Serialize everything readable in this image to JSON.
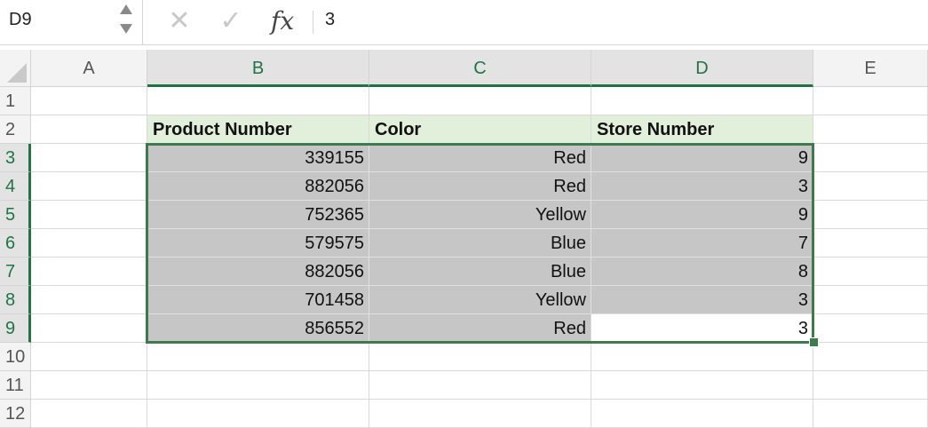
{
  "formula_bar": {
    "name_box": "D9",
    "cancel_icon": "✕",
    "enter_icon": "✓",
    "fx_label": "fx",
    "value": "3"
  },
  "columns": [
    "A",
    "B",
    "C",
    "D",
    "E"
  ],
  "rows": [
    "1",
    "2",
    "3",
    "4",
    "5",
    "6",
    "7",
    "8",
    "9",
    "10",
    "11",
    "12"
  ],
  "table": {
    "headers": [
      "Product Number",
      "Color",
      "Store Number"
    ],
    "rows": [
      [
        "339155",
        "Red",
        "9"
      ],
      [
        "882056",
        "Red",
        "3"
      ],
      [
        "752365",
        "Yellow",
        "9"
      ],
      [
        "579575",
        "Blue",
        "7"
      ],
      [
        "882056",
        "Blue",
        "8"
      ],
      [
        "701458",
        "Yellow",
        "3"
      ],
      [
        "856552",
        "Red",
        "3"
      ]
    ]
  },
  "selection": {
    "active_cell": "D9",
    "range": "B3:D9",
    "accent_color": "#217346",
    "fill_color": "#c6c6c6",
    "header_fill_color": "#e2efda"
  }
}
